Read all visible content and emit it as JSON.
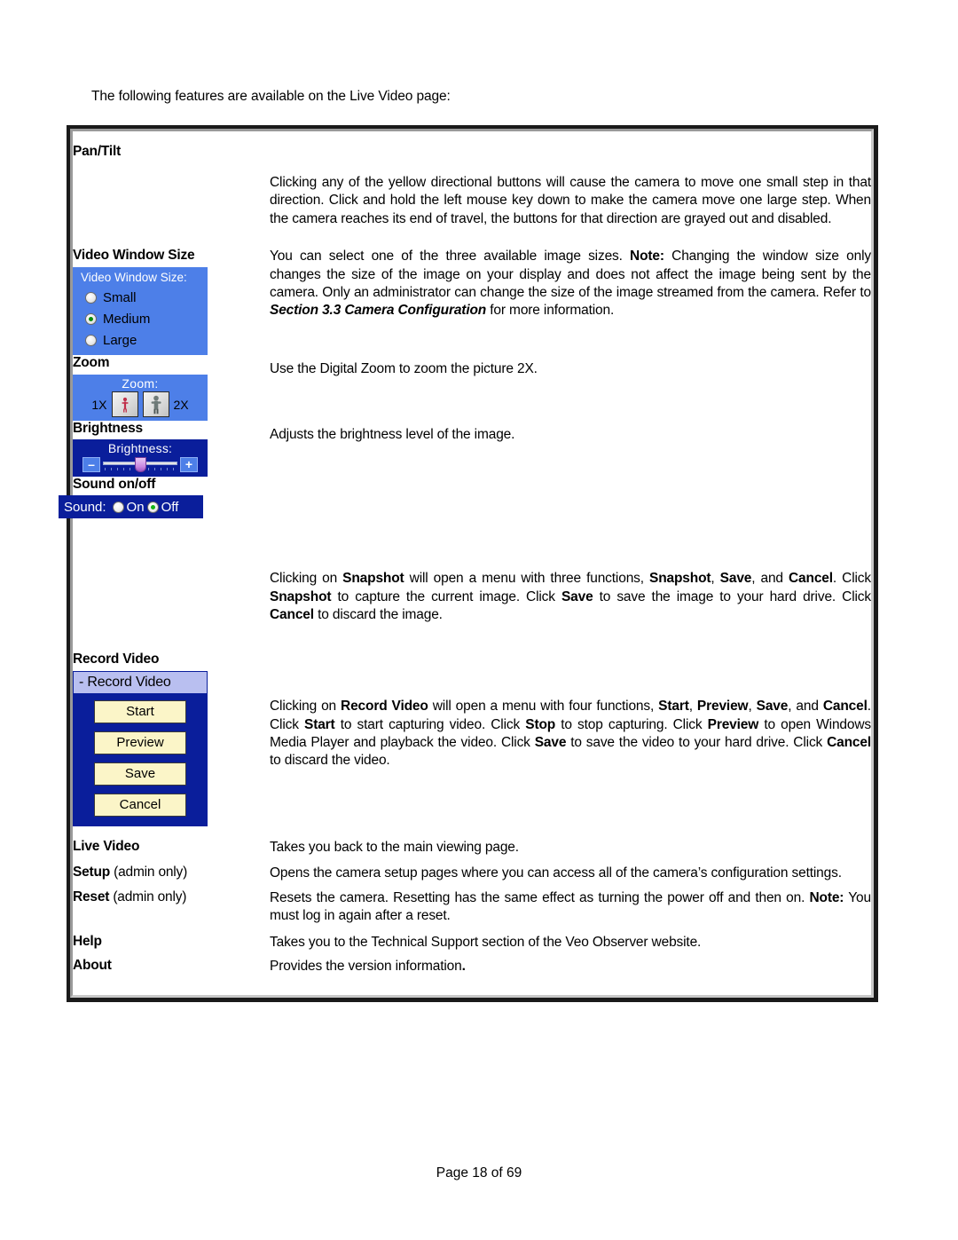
{
  "intro": "The following features are available on the Live Video page:",
  "footer": "Page 18 of 69",
  "colors": {
    "widget_blue": "#4d7fe8",
    "widget_navy": "#0a1e9b",
    "button_cream": "#fbf5c8",
    "title_lavender": "#b9bff0",
    "radio_green": "#0a8c0a"
  },
  "rows": {
    "pan_tilt": {
      "label": "Pan/Tilt",
      "desc_parts": [
        {
          "t": "Clicking any of the yellow directional buttons will cause the camera to move one small step in that direction. Click and hold the left mouse key down to make the camera move one large step. When the camera reaches its end of travel, the buttons for that direction are grayed out and disabled.",
          "s": "n"
        }
      ]
    },
    "video_window_size": {
      "label": "Video Window Size",
      "desc_parts": [
        {
          "t": "You can select one of the three available image sizes. ",
          "s": "n"
        },
        {
          "t": "Note:",
          "s": "b"
        },
        {
          "t": " Changing the window size only changes the size of the image on your display and does not affect the image being sent by the camera. Only an administrator can change the size of the image streamed from the camera. Refer to ",
          "s": "n"
        },
        {
          "t": "Section 3.3 Camera Configuration",
          "s": "bi"
        },
        {
          "t": " for more information.",
          "s": "n"
        }
      ],
      "widget": {
        "title": "Video Window Size:",
        "options": [
          {
            "label": "Small",
            "selected": false
          },
          {
            "label": "Medium",
            "selected": true
          },
          {
            "label": "Large",
            "selected": false
          }
        ]
      }
    },
    "zoom": {
      "label": "Zoom",
      "desc_parts": [
        {
          "t": "Use the Digital Zoom to zoom the picture 2X.",
          "s": "n"
        }
      ],
      "widget": {
        "title": "Zoom:",
        "left_label": "1X",
        "right_label": "2X",
        "left_icon": "person-small-icon",
        "right_icon": "person-large-icon"
      }
    },
    "brightness": {
      "label": "Brightness",
      "desc_parts": [
        {
          "t": "Adjusts the brightness level of the image.",
          "s": "n"
        }
      ],
      "widget": {
        "title": "Brightness:",
        "minus_label": "–",
        "plus_label": "+",
        "slider_value": 45
      }
    },
    "sound": {
      "label": "Sound on/off",
      "desc_parts": [],
      "widget": {
        "title": "Sound:",
        "options": [
          {
            "label": "On",
            "selected": false
          },
          {
            "label": "Off",
            "selected": true
          }
        ]
      }
    },
    "snapshot": {
      "label": "",
      "desc_parts": [
        {
          "t": "Clicking on ",
          "s": "n"
        },
        {
          "t": "Snapshot",
          "s": "b"
        },
        {
          "t": " will open a menu with three functions, ",
          "s": "n"
        },
        {
          "t": "Snapshot",
          "s": "b"
        },
        {
          "t": ", ",
          "s": "n"
        },
        {
          "t": "Save",
          "s": "b"
        },
        {
          "t": ", and ",
          "s": "n"
        },
        {
          "t": "Cancel",
          "s": "b"
        },
        {
          "t": ". Click ",
          "s": "n"
        },
        {
          "t": "Snapshot",
          "s": "b"
        },
        {
          "t": " to capture the current image. Click ",
          "s": "n"
        },
        {
          "t": "Save",
          "s": "b"
        },
        {
          "t": " to save the image to your hard drive. Click ",
          "s": "n"
        },
        {
          "t": "Cancel",
          "s": "b"
        },
        {
          "t": " to discard the image.",
          "s": "n"
        }
      ]
    },
    "record_video": {
      "label": "Record Video",
      "desc_parts": [
        {
          "t": "Clicking on ",
          "s": "n"
        },
        {
          "t": "Record Video",
          "s": "b"
        },
        {
          "t": " will open a menu with four functions, ",
          "s": "n"
        },
        {
          "t": "Start",
          "s": "b"
        },
        {
          "t": ", ",
          "s": "n"
        },
        {
          "t": "Preview",
          "s": "b"
        },
        {
          "t": ", ",
          "s": "n"
        },
        {
          "t": "Save",
          "s": "b"
        },
        {
          "t": ", and ",
          "s": "n"
        },
        {
          "t": "Cancel",
          "s": "b"
        },
        {
          "t": ". Click ",
          "s": "n"
        },
        {
          "t": "Start",
          "s": "b"
        },
        {
          "t": " to start capturing video. Click ",
          "s": "n"
        },
        {
          "t": "Stop",
          "s": "b"
        },
        {
          "t": " to stop capturing. Click ",
          "s": "n"
        },
        {
          "t": "Preview",
          "s": "b"
        },
        {
          "t": " to open Windows Media Player and playback the video. Click ",
          "s": "n"
        },
        {
          "t": "Save",
          "s": "b"
        },
        {
          "t": " to save the video to your hard drive. Click ",
          "s": "n"
        },
        {
          "t": "Cancel",
          "s": "b"
        },
        {
          "t": " to discard the video.",
          "s": "n"
        }
      ],
      "widget": {
        "title": "- Record Video",
        "buttons": [
          "Start",
          "Preview",
          "Save",
          "Cancel"
        ]
      }
    },
    "live_video": {
      "label": "Live Video",
      "desc_parts": [
        {
          "t": "Takes you back to the main viewing page.",
          "s": "n"
        }
      ]
    },
    "setup": {
      "label": "Setup",
      "label_suffix": " (admin only)",
      "desc_parts": [
        {
          "t": "Opens the camera setup pages where you can access all of the camera’s configuration settings.",
          "s": "n"
        }
      ]
    },
    "reset": {
      "label": "Reset",
      "label_suffix": " (admin only)",
      "desc_parts": [
        {
          "t": "Resets the camera. Resetting has the same effect as turning the power off and then on. ",
          "s": "n"
        },
        {
          "t": "Note:",
          "s": "b"
        },
        {
          "t": " You must log in again after a reset.",
          "s": "n"
        }
      ]
    },
    "help": {
      "label": "Help",
      "desc_parts": [
        {
          "t": "Takes you to the Technical Support section of the Veo Observer website.",
          "s": "n"
        }
      ]
    },
    "about": {
      "label": "About",
      "desc_parts": [
        {
          "t": "Provides the version information",
          "s": "n"
        },
        {
          "t": ".",
          "s": "b"
        }
      ]
    }
  }
}
